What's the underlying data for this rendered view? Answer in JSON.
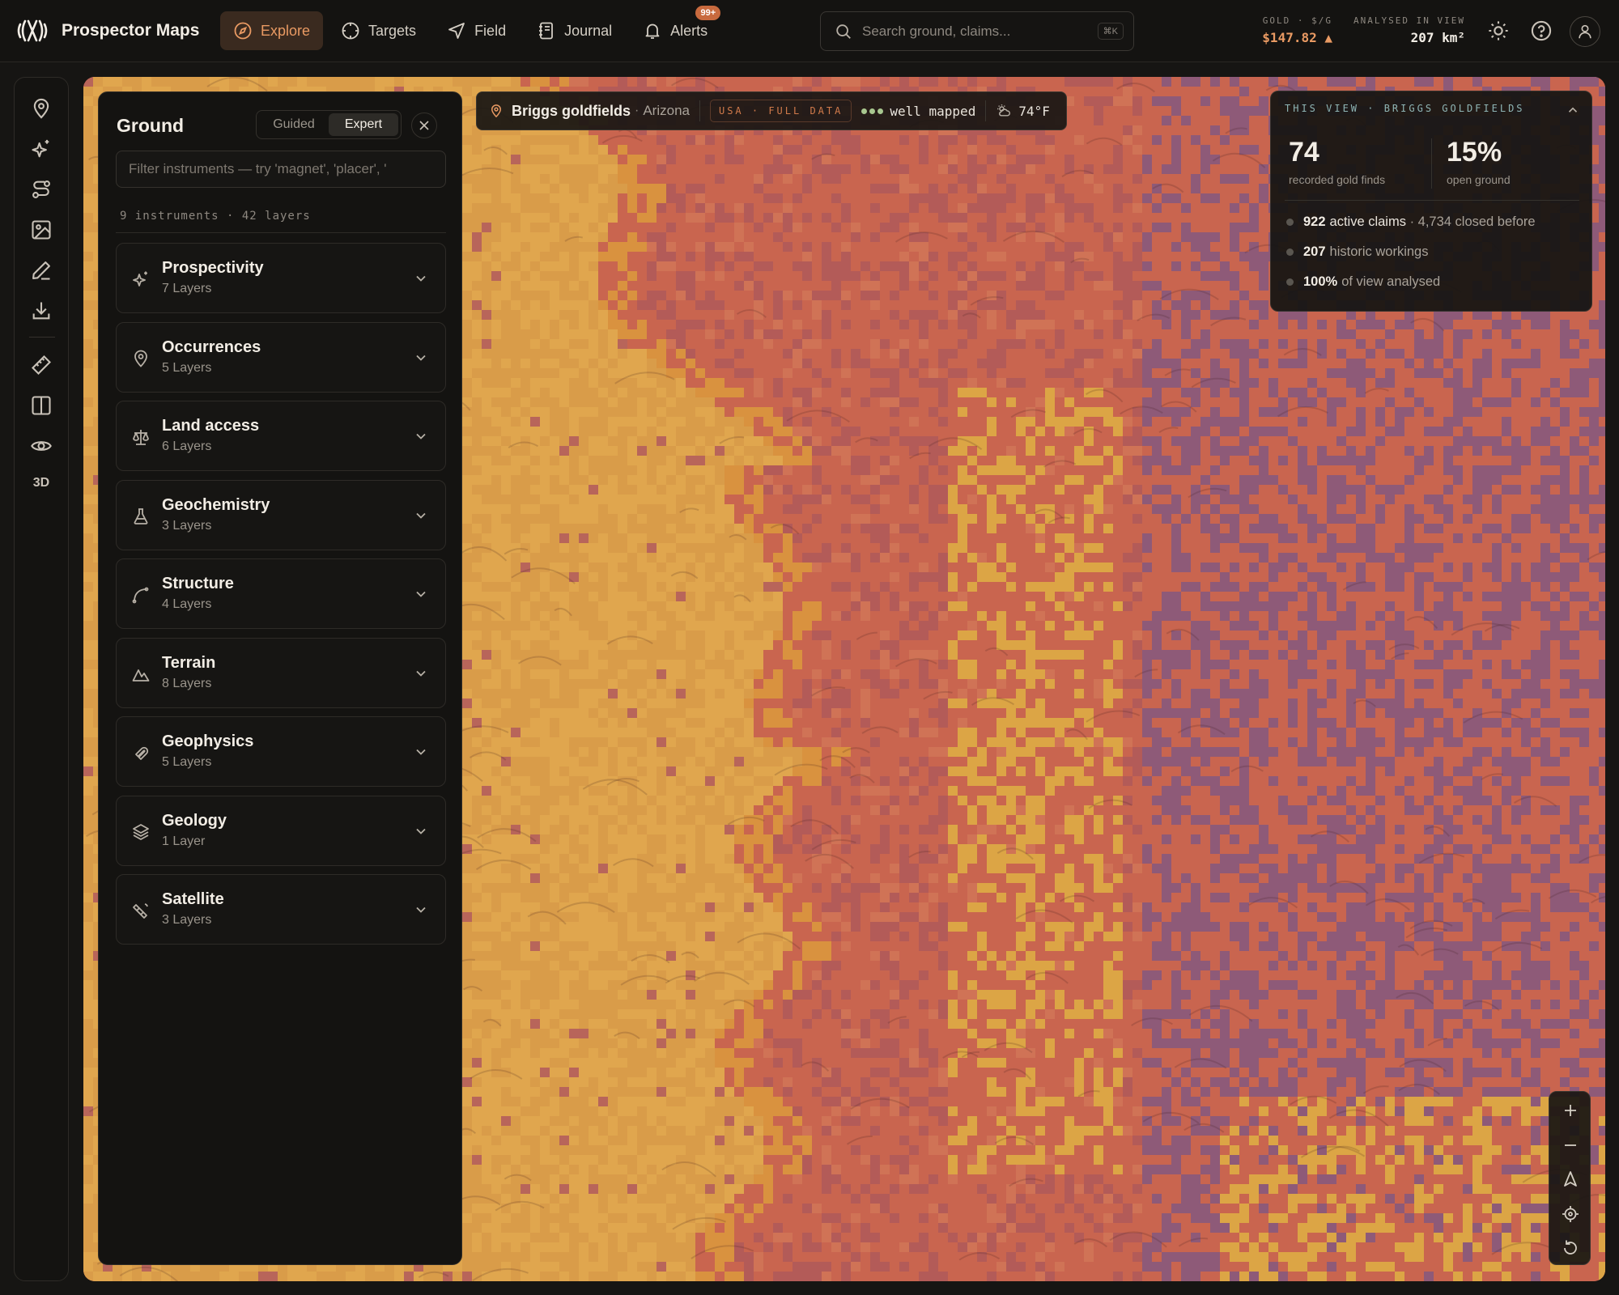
{
  "app": {
    "name": "Prospector Maps"
  },
  "nav": [
    {
      "label": "Explore",
      "icon": "compass-icon",
      "active": true
    },
    {
      "label": "Targets",
      "icon": "crosshair-icon"
    },
    {
      "label": "Field",
      "icon": "navigation-icon"
    },
    {
      "label": "Journal",
      "icon": "notebook-icon"
    },
    {
      "label": "Alerts",
      "icon": "bell-icon",
      "badge": "99+"
    }
  ],
  "search": {
    "placeholder": "Search ground, claims...",
    "shortcut": "⌘K"
  },
  "stats": {
    "gold_label": "GOLD · $/G",
    "gold_value": "$147.82 ▲",
    "area_label": "ANALYSED IN VIEW",
    "area_value": "207 km²"
  },
  "rail": {
    "items": [
      "pin-icon",
      "sparkle-icon",
      "route-icon",
      "image-icon",
      "pencil-icon",
      "download-icon",
      "ruler-icon",
      "split-view-icon",
      "eye-icon"
    ],
    "label_3d": "3D"
  },
  "panel": {
    "title": "Ground",
    "modes": [
      "Guided",
      "Expert"
    ],
    "active_mode": "Expert",
    "filter_placeholder": "Filter instruments — try 'magnet', 'placer', '",
    "count": "9 instruments · 42 layers",
    "groups": [
      {
        "name": "Prospectivity",
        "sub": "7 Layers",
        "icon": "sparkle-icon"
      },
      {
        "name": "Occurrences",
        "sub": "5 Layers",
        "icon": "map-pin-icon"
      },
      {
        "name": "Land access",
        "sub": "6 Layers",
        "icon": "scale-icon"
      },
      {
        "name": "Geochemistry",
        "sub": "3 Layers",
        "icon": "flask-icon"
      },
      {
        "name": "Structure",
        "sub": "4 Layers",
        "icon": "curve-icon"
      },
      {
        "name": "Terrain",
        "sub": "8 Layers",
        "icon": "mountain-icon"
      },
      {
        "name": "Geophysics",
        "sub": "5 Layers",
        "icon": "magnet-icon"
      },
      {
        "name": "Geology",
        "sub": "1 Layer",
        "icon": "layers-icon"
      },
      {
        "name": "Satellite",
        "sub": "3 Layers",
        "icon": "satellite-icon"
      }
    ]
  },
  "location": {
    "name": "Briggs goldfields",
    "region": "Arizona",
    "coverage": "USA · FULL DATA",
    "quality": "well mapped",
    "temp": "74°F"
  },
  "view_card": {
    "title": "THIS VIEW · BRIGGS GOLDFIELDS",
    "finds": "74",
    "finds_label": "recorded gold finds",
    "open": "15%",
    "open_label": "open ground",
    "rows": [
      {
        "value": "922",
        "text": "active claims",
        "extra": "· 4,734 closed before"
      },
      {
        "value": "207",
        "text": "historic workings",
        "extra": ""
      },
      {
        "value": "100%",
        "text": "of view analysed",
        "extra": ""
      }
    ]
  },
  "map_controls": [
    "zoom-in-icon",
    "zoom-out-icon",
    "compass-north-icon",
    "locate-icon",
    "reset-view-icon"
  ],
  "colors": {
    "accent": "#e99a63",
    "prospective_high": "#e2a54f",
    "prospective_mid": "#c9654f",
    "prospective_low": "#8e5a78"
  }
}
